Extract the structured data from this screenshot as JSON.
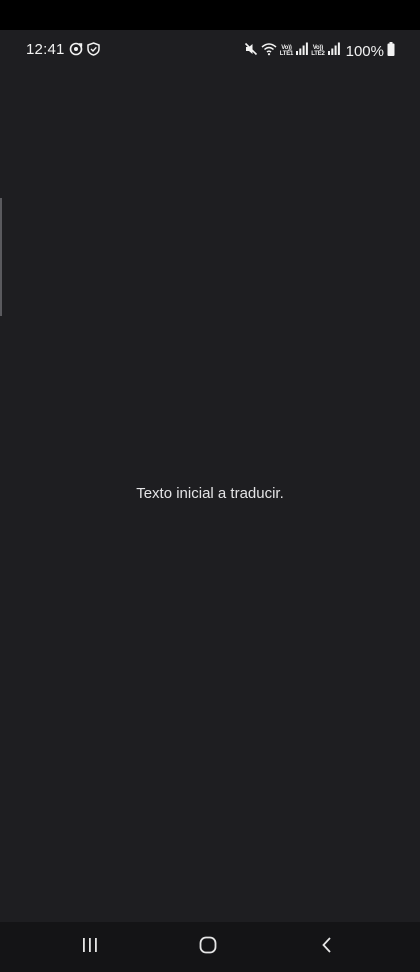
{
  "status_bar": {
    "time": "12:41",
    "left_icons": [
      "sync-icon",
      "shield-icon"
    ],
    "right_icons": [
      "mute-icon",
      "wifi-icon",
      "volte-lte1-icon",
      "signal-icon",
      "volte-lte2-icon",
      "signal-icon",
      "battery-icon"
    ],
    "volte1": {
      "top": "Vo))",
      "bottom": "LTE1"
    },
    "volte2": {
      "top": "Vo))",
      "bottom": "LTE2"
    },
    "battery": "100%"
  },
  "main": {
    "text": "Texto inicial a traducir."
  },
  "nav_bar": {
    "buttons": [
      "recent-apps-icon",
      "home-icon",
      "back-icon"
    ]
  },
  "colors": {
    "background": "#1e1e21",
    "nav_background": "#141416",
    "text": "#e4e4e6"
  }
}
